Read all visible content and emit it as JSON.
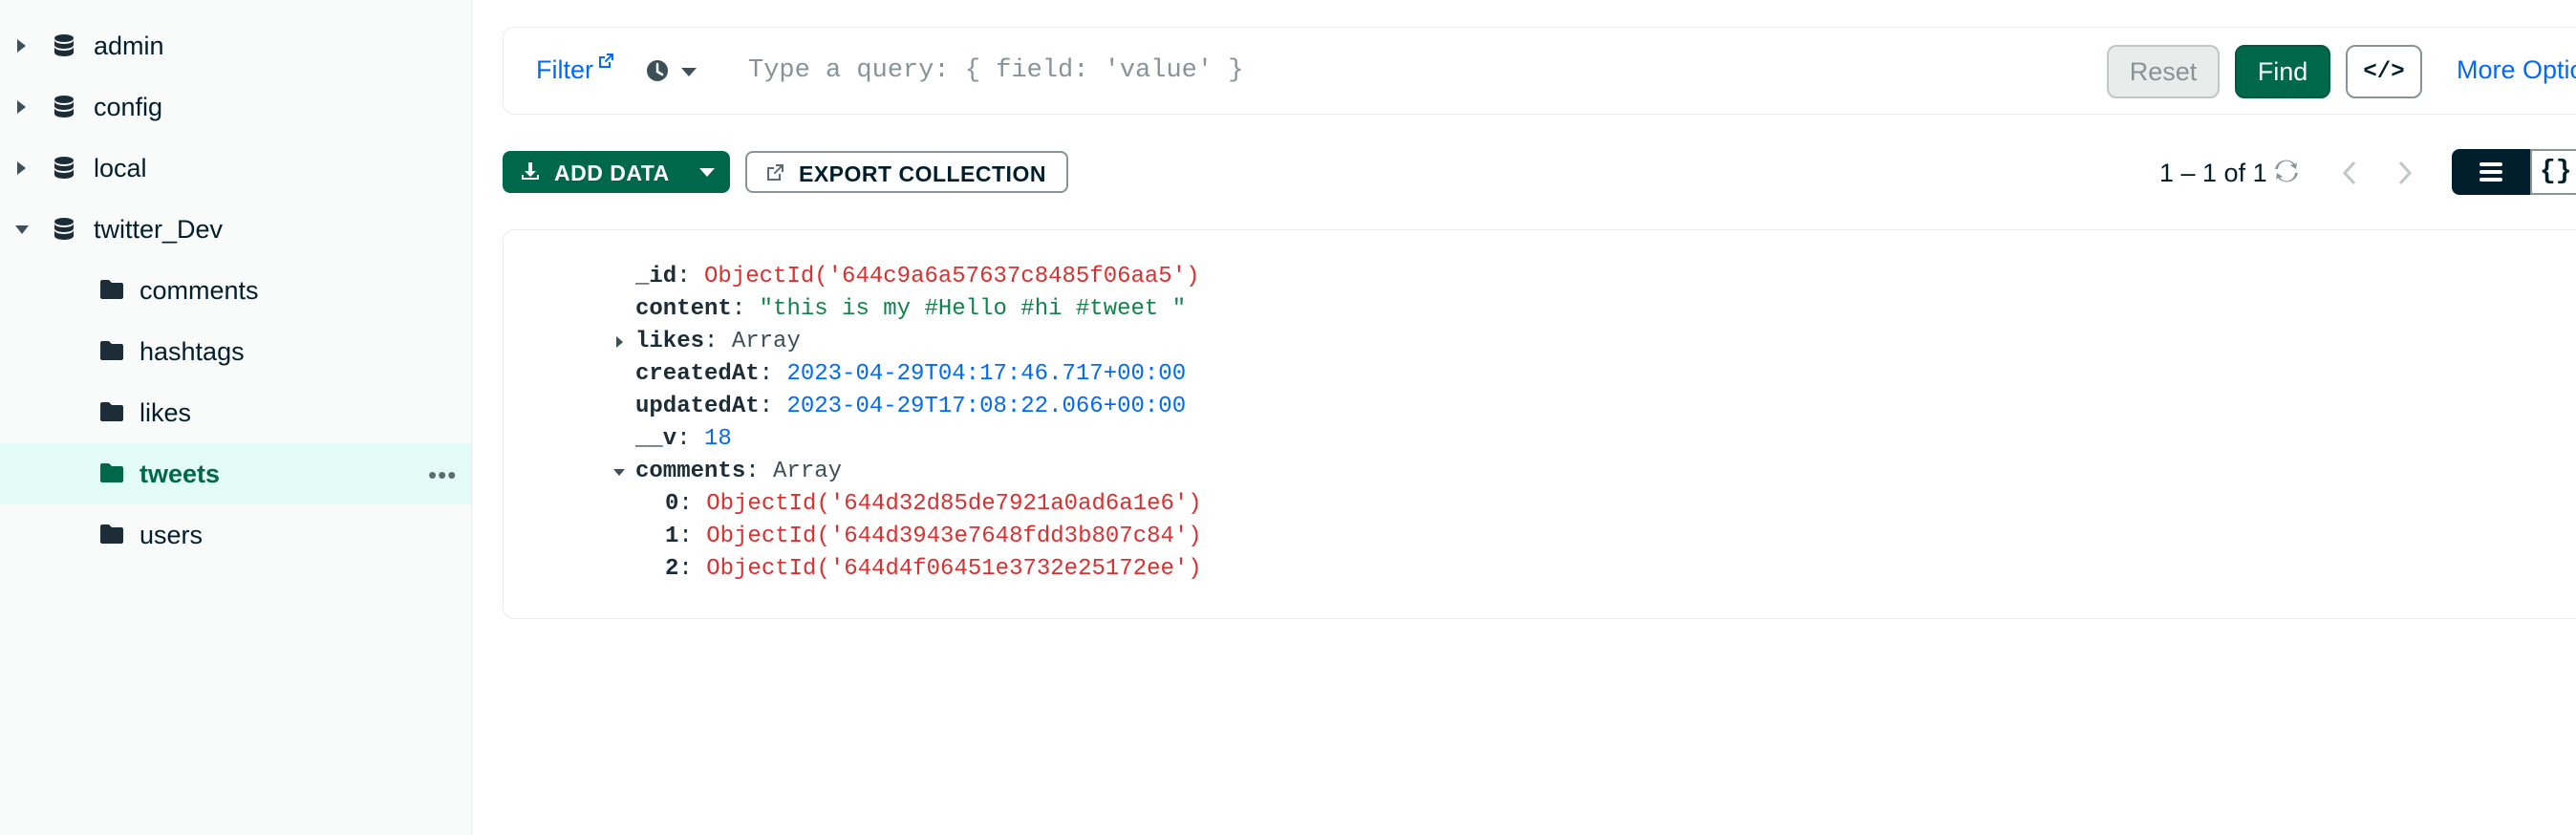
{
  "sidebar": {
    "databases": [
      {
        "name": "admin",
        "expanded": false
      },
      {
        "name": "config",
        "expanded": false
      },
      {
        "name": "local",
        "expanded": false
      },
      {
        "name": "twitter_Dev",
        "expanded": true
      }
    ],
    "collections": [
      "comments",
      "hashtags",
      "likes",
      "tweets",
      "users"
    ],
    "active_collection": "tweets",
    "more_icon": "ellipsis-icon"
  },
  "filter": {
    "label": "Filter",
    "placeholder": "Type a query: { field: 'value' }",
    "reset_label": "Reset",
    "find_label": "Find",
    "code_label": "</>",
    "more_options_label": "More Options"
  },
  "toolbar": {
    "add_data_label": "ADD DATA",
    "export_label": "EXPORT COLLECTION",
    "pager_text": "1 – 1 of 1",
    "json_view_label": "{}"
  },
  "document": {
    "id_key": "_id",
    "id_value": "ObjectId('644c9a6a57637c8485f06aa5')",
    "content_key": "content",
    "content_value": "\"this is my #Hello #hi #tweet \"",
    "likes_key": "likes",
    "likes_type": "Array",
    "createdAt_key": "createdAt",
    "createdAt_value": "2023-04-29T04:17:46.717+00:00",
    "updatedAt_key": "updatedAt",
    "updatedAt_value": "2023-04-29T17:08:22.066+00:00",
    "v_key": "__v",
    "v_value": "18",
    "comments_key": "comments",
    "comments_type": "Array",
    "comments": [
      {
        "index": "0",
        "value": "ObjectId('644d32d85de7921a0ad6a1e6')"
      },
      {
        "index": "1",
        "value": "ObjectId('644d3943e7648fdd3b807c84')"
      },
      {
        "index": "2",
        "value": "ObjectId('644d4f06451e3732e25172ee')"
      }
    ]
  },
  "colors": {
    "accent_green": "#00684a",
    "link_blue": "#016bf8",
    "objectid_red": "#db3030",
    "string_green": "#12824d",
    "active_bg": "#e3fcf7"
  }
}
